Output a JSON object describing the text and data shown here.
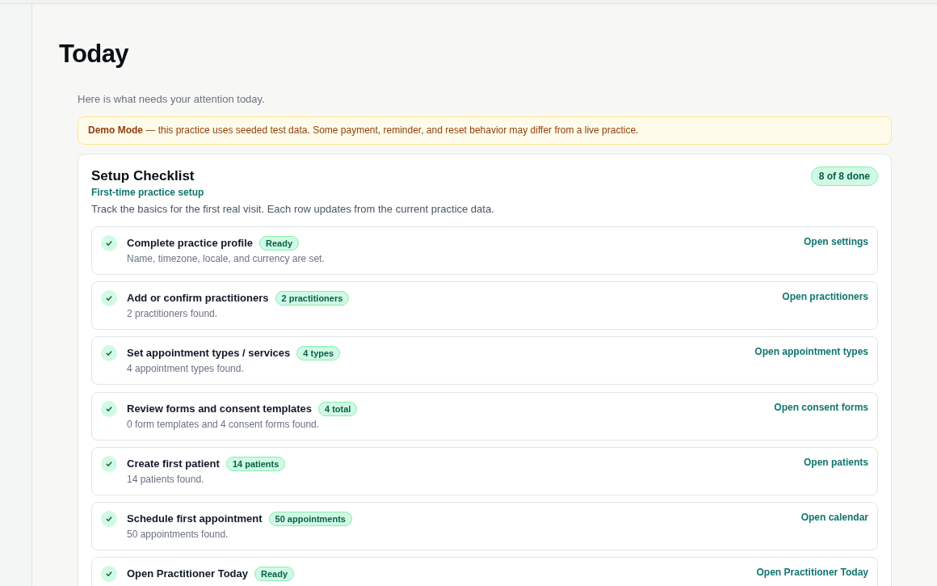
{
  "page": {
    "title": "Today",
    "subtitle": "Here is what needs your attention today."
  },
  "banner": {
    "text": "**Demo Mode** — this practice uses seeded test data. Some payment, reminder, and reset behavior may differ from a live practice."
  },
  "checklist": {
    "title": "Setup Checklist",
    "badge": "8 of 8 done",
    "subtitle": "First-time practice setup",
    "description": "Track the basics for the first real visit. Each row updates from the current practice data.",
    "items": [
      {
        "title": "Complete practice profile",
        "badge": "Ready",
        "detail": "Name, timezone, locale, and currency are set.",
        "link": "Open settings",
        "done": true
      },
      {
        "title": "Add or confirm practitioners",
        "badge": "2 practitioners",
        "detail": "2 practitioners found.",
        "link": "Open practitioners",
        "done": true
      },
      {
        "title": "Set appointment types / services",
        "badge": "4 types",
        "detail": "4 appointment types found.",
        "link": "Open appointment types",
        "done": true
      },
      {
        "title": "Review forms and consent templates",
        "badge": "4 total",
        "detail": "0 form templates and 4 consent forms found.",
        "link": "Open consent forms",
        "done": true
      },
      {
        "title": "Create first patient",
        "badge": "14 patients",
        "detail": "14 patients found.",
        "link": "Open patients",
        "done": true
      },
      {
        "title": "Schedule first appointment",
        "badge": "50 appointments",
        "detail": "50 appointments found.",
        "link": "Open calendar",
        "done": true
      },
      {
        "title": "Open Practitioner Today",
        "badge": "Ready",
        "link": "Open Practitioner Today",
        "done": true
      }
    ]
  }
}
